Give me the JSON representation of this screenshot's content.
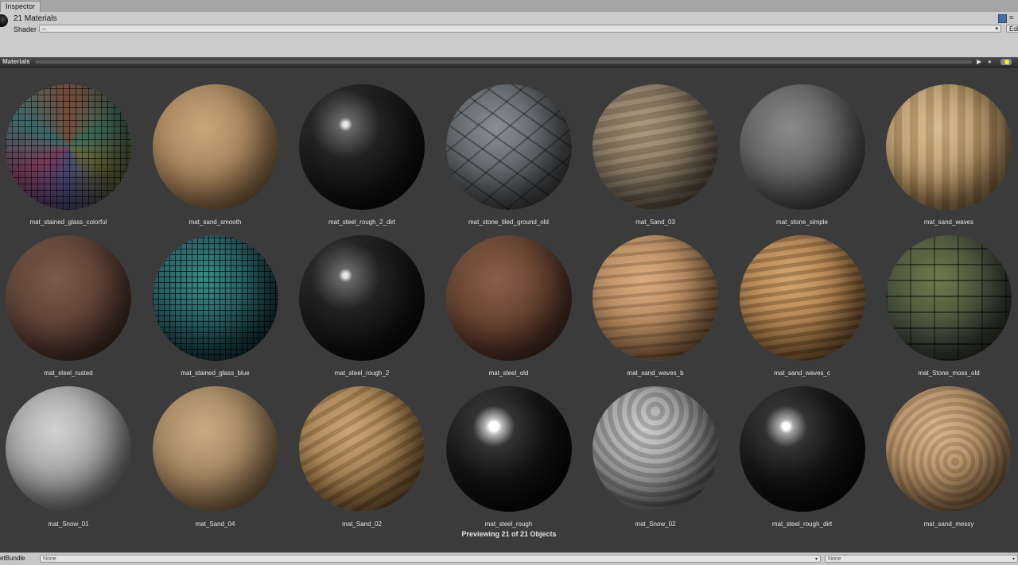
{
  "inspector": {
    "tab_label": "Inspector",
    "title": "21 Materials",
    "shader_label": "Shader",
    "shader_value": "--",
    "edit_label": "Edi"
  },
  "preview": {
    "label": "Materials",
    "status": "Previewing 21 of 21 Objects",
    "materials": [
      {
        "name": "mat_stained_glass_colorful",
        "look": "m-glass-color"
      },
      {
        "name": "mat_sand_smooth",
        "look": "m-sand-smooth"
      },
      {
        "name": "mat_steel_rough_2_dirt",
        "look": "m-steel-dark"
      },
      {
        "name": "mat_stone_tiled_ground_old",
        "look": "m-stone-tiled"
      },
      {
        "name": "mat_Sand_03",
        "look": "m-sand-waves"
      },
      {
        "name": "mat_stone_simple",
        "look": "m-stone-simple"
      },
      {
        "name": "mat_sand_waves",
        "look": "m-sand-vwaves"
      },
      {
        "name": "mat_steel_rusted",
        "look": "m-rusted"
      },
      {
        "name": "mat_stained_glass_blue",
        "look": "m-glass-blue"
      },
      {
        "name": "mat_steel_rough_2",
        "look": "m-steel-dark"
      },
      {
        "name": "mat_steel_old",
        "look": "m-steel-old"
      },
      {
        "name": "mat_sand_waves_b",
        "look": "m-sand-waves-b"
      },
      {
        "name": "mat_sand_waves_c",
        "look": "m-sand-waves-c"
      },
      {
        "name": "mat_Stone_moss_old",
        "look": "m-stone-moss"
      },
      {
        "name": "mat_Snow_01",
        "look": "m-snow"
      },
      {
        "name": "mat_Sand_04",
        "look": "m-sand-04"
      },
      {
        "name": "mat_Sand_02",
        "look": "m-sand-02"
      },
      {
        "name": "mat_steel_rough",
        "look": "m-steel-glossy"
      },
      {
        "name": "mat_Snow_02",
        "look": "m-snow-02"
      },
      {
        "name": "mat_steel_rough_dirt",
        "look": "m-steel-rough-dirt"
      },
      {
        "name": "mat_sand_messy",
        "look": "m-sand-messy"
      }
    ]
  },
  "assetbundle": {
    "label": "etBundle",
    "value1": "None",
    "value2": "None"
  }
}
